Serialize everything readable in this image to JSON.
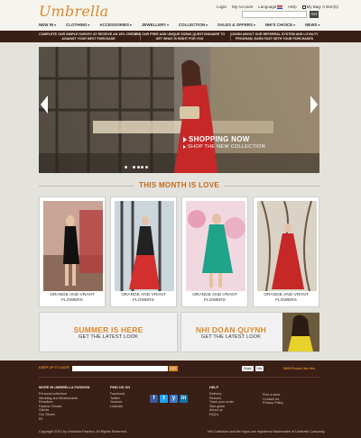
{
  "header": {
    "logo": "Umbrella",
    "links": {
      "login": "Login",
      "my_account": "My Account",
      "language": "Language",
      "help": "Help",
      "bag": "My Bag: 0 item(s)"
    },
    "search": {
      "placeholder": "",
      "go_label": "GO"
    }
  },
  "nav": {
    "items": [
      {
        "label": "NEW IN"
      },
      {
        "label": "CLOTHING"
      },
      {
        "label": "ACCESSORIES"
      },
      {
        "label": "JEWELLERY"
      },
      {
        "label": "COLLECTION"
      },
      {
        "label": "SALES & OFFERS"
      },
      {
        "label": "NHI'S CHOICE"
      },
      {
        "label": "NEWS"
      }
    ]
  },
  "promo": [
    "COMPLETE OUR SIMPLE SURVEY AT RECEIVE AN 15% CREDIT AGAINST YOUR NEXT PURCHASE",
    "USE OUR FREE AND UNIQUE SIZING QUESTIONNAIRE TO GET WHAT IS RIGHT FOR YOU",
    "LEARN ABOUT OUR REFERRAL SYSTEM AND LOYALTY PROGRAM, EARN FAST WITH YOUR PURCHASES"
  ],
  "hero": {
    "cta_main": "SHOPPING NOW",
    "cta_sub": "SHOP THE NEW COLLECTION",
    "slides": 6,
    "active_slide": 1,
    "colors": {
      "sky": "#d2dbe0",
      "building": "#5a4a3a",
      "dress": "#c62828"
    }
  },
  "month": {
    "title": "THIS MONTH IS LOVE",
    "cards": [
      {
        "caption_line1": "ORANGE AND VRANT",
        "caption_line2": "FLOWERS"
      },
      {
        "caption_line1": "ORANGE AND VRANT",
        "caption_line2": "FLOWERS"
      },
      {
        "caption_line1": "ORANGE AND VRANT",
        "caption_line2": "FLOWERS"
      },
      {
        "caption_line1": "ORANGE AND VRANT",
        "caption_line2": "FLOWERS"
      }
    ]
  },
  "banners": [
    {
      "title": "SUMMER IS HERE",
      "subtitle": "GET THE LATEST LOOK"
    },
    {
      "title": "NHI DOAN QUYNH",
      "subtitle": "GET THE LATEST LOOK"
    }
  ],
  "footer": {
    "keep_up": "KEEP UP TO DATE",
    "newsletter_go": "GO",
    "share": "Share",
    "like": "Like",
    "likes_count": "5905 People like this",
    "columns": [
      {
        "title": "MORE IN UMBRELLA FASHION",
        "links": [
          "Personal collection",
          "Wedding and Bridesmaids",
          "Resellers",
          "Fashion Shows",
          "Clients",
          "Our Stores",
          "Eli"
        ]
      },
      {
        "title": "FIND US ON",
        "links": [
          "Facebook",
          "Twitter",
          "Youtube",
          "LinkedIn"
        ]
      },
      {
        "title": "HELP",
        "links": [
          "Delivery",
          "Returns",
          "Track your order",
          "Size guide",
          "About us",
          "FAQ's"
        ]
      },
      {
        "title": "",
        "links": [
          "Find a store",
          "Contact Us",
          "Privacy Policy"
        ]
      }
    ],
    "copyright_left": "Copyright 2012 by Umbrella Fashion. All Rights Reserved.",
    "copyright_right": "Nhi Collection and the logos are registered trademarks of Umbrella Company."
  },
  "colors": {
    "brand_orange": "#d98a2c",
    "footer_brown": "#3a1f17",
    "title_orange": "#c26a1c"
  }
}
